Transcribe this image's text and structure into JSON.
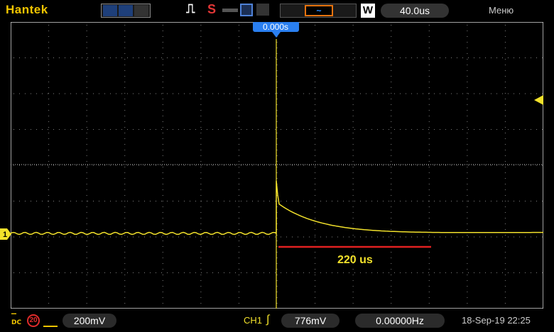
{
  "header": {
    "brand": "Hantek",
    "s_label": "S",
    "w_label": "W",
    "timebase": "40.0us",
    "menu_label": "Меню"
  },
  "screen": {
    "trigger_time_label": "0.000s",
    "channel_marker_label": "1",
    "annotation_text": "220 us",
    "colors": {
      "trace": "#f2e12b",
      "grid": "#7f7f7f",
      "annotation": "#e02020",
      "trigger_tag": "#2a7ff0"
    }
  },
  "footer": {
    "bw_label": "20",
    "ch_scale": "200mV",
    "trigger_channel": "CH1",
    "trigger_level": "776mV",
    "frequency": "0.00000Hz",
    "datetime": "18-Sep-19 22:25"
  },
  "icons": [
    "wave-icon",
    "line-icon",
    "pulse-icon",
    "save-icon",
    "print-icon",
    "dc-icon",
    "probe-icon"
  ]
}
